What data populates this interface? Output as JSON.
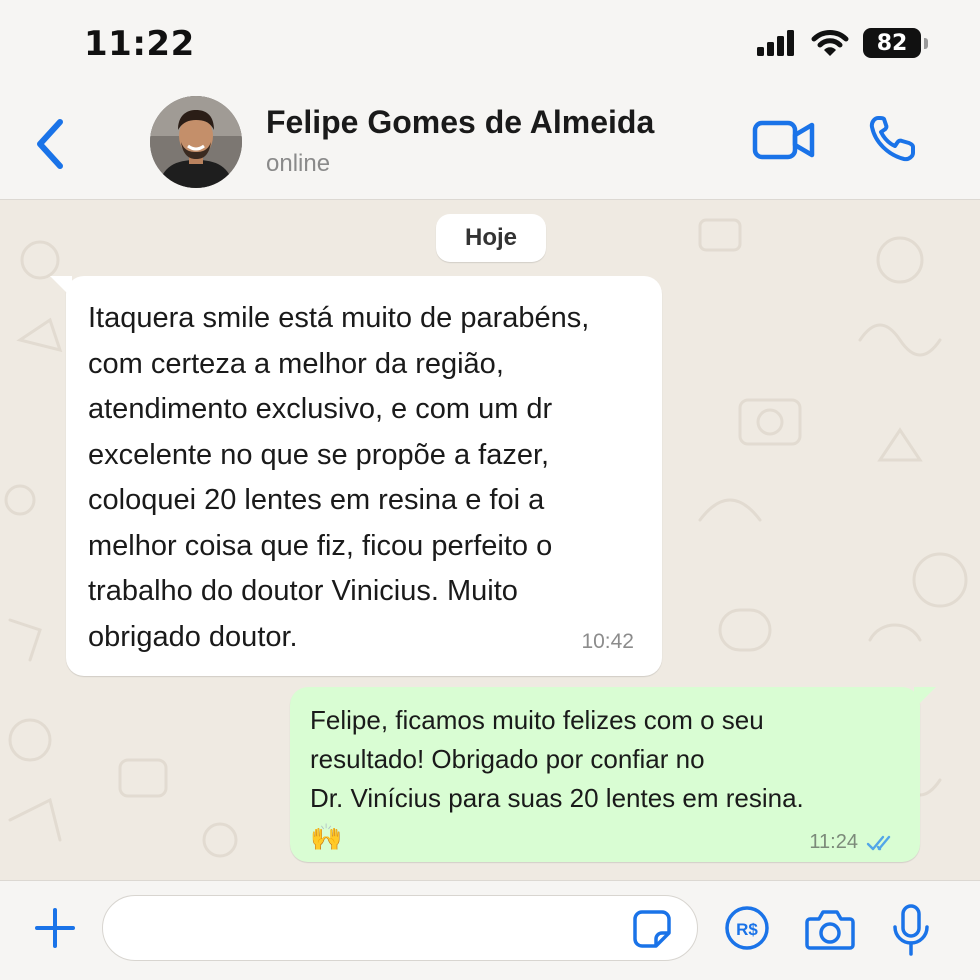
{
  "status_bar": {
    "time": "11:22",
    "battery_level": "82",
    "icons": [
      "signal-icon",
      "wifi-icon",
      "battery-icon"
    ]
  },
  "header": {
    "contact_name": "Felipe Gomes de Almeida",
    "contact_status": "online",
    "icons": [
      "back-chevron-icon",
      "video-camera-icon",
      "phone-icon"
    ]
  },
  "chat": {
    "date_label": "Hoje",
    "messages": [
      {
        "direction": "incoming",
        "text": "Itaquera smile está muito de parabéns,\ncom certeza a melhor da região,\natendimento exclusivo, e com um dr\nexcelente no que se propõe a fazer,\ncoloquei 20 lentes em resina e foi a\nmelhor coisa que fiz, ficou perfeito o\ntrabalho do doutor Vinicius. Muito\nobrigado doutor.",
        "time": "10:42"
      },
      {
        "direction": "outgoing",
        "text": "Felipe, ficamos muito felizes com o seu\nresultado! Obrigado por confiar no\nDr. Vinícius para suas 20 lentes em resina.\n🙌",
        "time": "11:24",
        "status": "read"
      }
    ]
  },
  "input_bar": {
    "placeholder": "",
    "icons": [
      "plus-icon",
      "sticker-icon",
      "payment-icon",
      "camera-icon",
      "microphone-icon"
    ]
  },
  "colors": {
    "accent": "#1a73e8",
    "incoming_bubble": "#ffffff",
    "outgoing_bubble": "#d9fdd3",
    "chat_background": "#efeae2",
    "read_ticks": "#53a6e8"
  }
}
